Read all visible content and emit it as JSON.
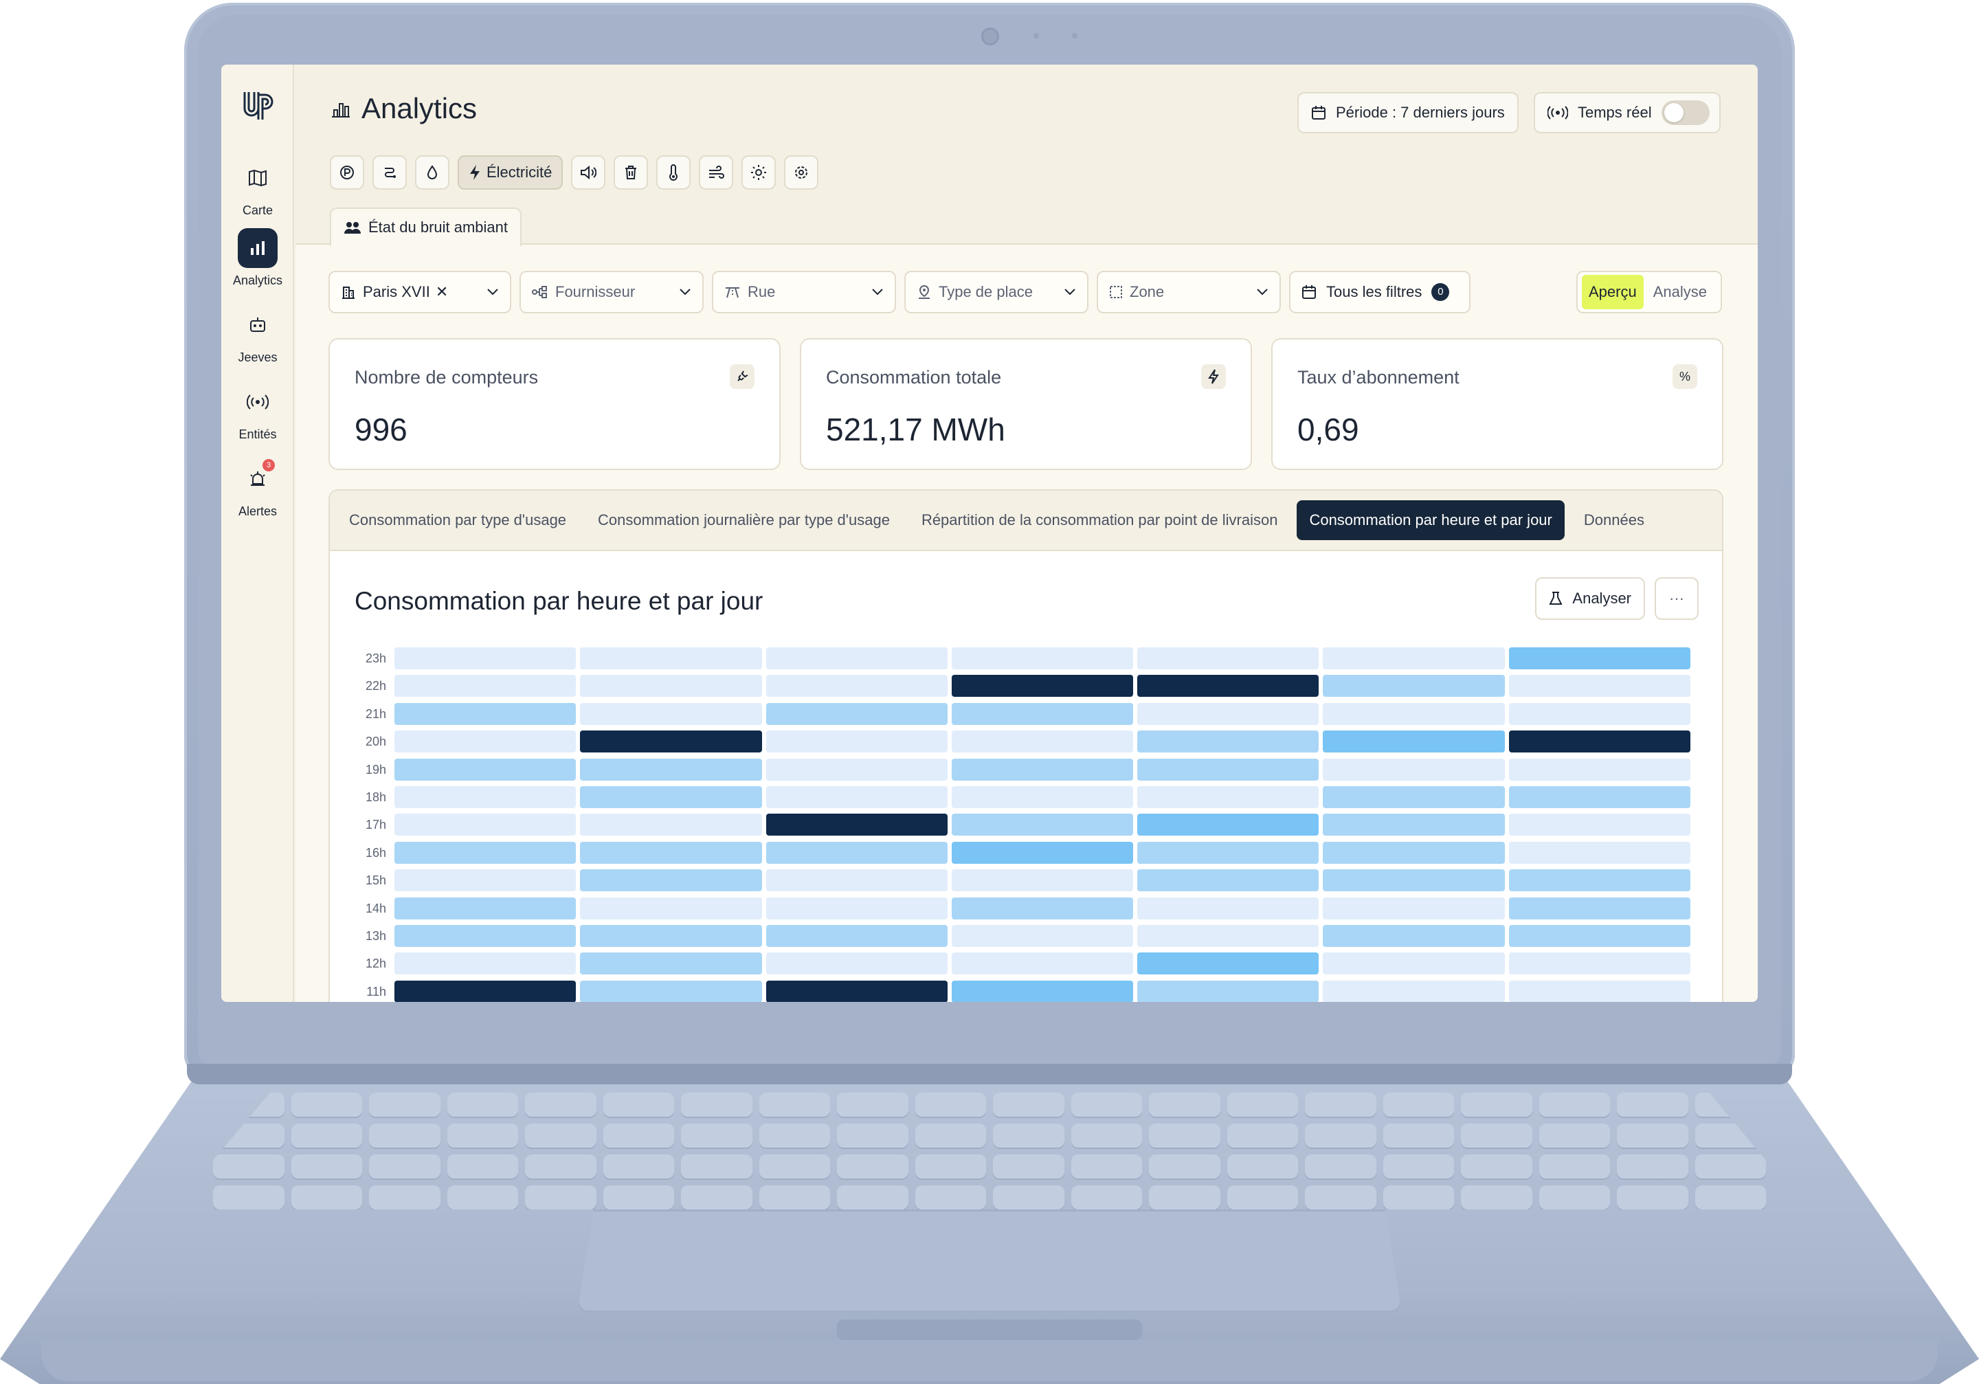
{
  "app": {
    "page_title": "Analytics",
    "period_label": "Période : 7 derniers jours",
    "realtime_label": "Temps réel",
    "realtime_on": false,
    "active_category": "Électricité",
    "subtab_label": "État du bruit ambiant"
  },
  "sidebar": {
    "items": [
      {
        "label": "Carte",
        "icon": "map-icon",
        "active": false
      },
      {
        "label": "Analytics",
        "icon": "bar-chart-icon",
        "active": true
      },
      {
        "label": "Jeeves",
        "icon": "robot-icon",
        "active": false
      },
      {
        "label": "Entités",
        "icon": "broadcast-icon",
        "active": false
      },
      {
        "label": "Alertes",
        "icon": "siren-icon",
        "active": false,
        "badge": "3"
      }
    ]
  },
  "categories": [
    "parking-icon",
    "route-icon",
    "water-drop-icon",
    "lightning-icon",
    "speaker-icon",
    "trash-icon",
    "thermometer-icon",
    "wind-icon",
    "sun-icon",
    "settings-icon"
  ],
  "filters": {
    "city_chip": "Paris XVII",
    "supplier": "Fournisseur",
    "street": "Rue",
    "place_type": "Type de place",
    "zone": "Zone",
    "all_filters": "Tous les filtres",
    "all_filters_count": "0"
  },
  "view_toggle": {
    "selected": "Aperçu",
    "other": "Analyse"
  },
  "kpis": [
    {
      "label": "Nombre de compteurs",
      "value": "996",
      "icon": "plug-icon"
    },
    {
      "label": "Consommation totale",
      "value": "521,17 MWh",
      "icon": "lightning-icon"
    },
    {
      "label": "Taux d’abonnement",
      "value": "0,69",
      "icon": "percent-icon"
    }
  ],
  "chart_tabs": [
    "Consommation par type d'usage",
    "Consommation journalière par type d'usage",
    "Répartition de la consommation par point de livraison",
    "Consommation par heure et par jour",
    "Données"
  ],
  "active_chart_tab": 3,
  "chart_buttons": {
    "analyse": "Analyser",
    "more": "···"
  },
  "colors": {
    "level0": "#e1edfb",
    "level1": "#a9d6f6",
    "level2": "#79c4f5",
    "level3": "#0f2a4a",
    "accent": "#e4f75f",
    "dark": "#16263b"
  },
  "chart_data": {
    "type": "heatmap",
    "title": "Consommation par heure et par jour",
    "y": [
      "23h",
      "22h",
      "21h",
      "20h",
      "19h",
      "18h",
      "17h",
      "16h",
      "15h",
      "14h",
      "13h",
      "12h",
      "11h"
    ],
    "x_count": 7,
    "levels": [
      [
        0,
        0,
        0,
        0,
        0,
        0,
        2
      ],
      [
        0,
        0,
        0,
        3,
        3,
        1,
        0
      ],
      [
        1,
        0,
        1,
        1,
        0,
        0,
        0
      ],
      [
        0,
        3,
        0,
        0,
        1,
        2,
        3
      ],
      [
        1,
        1,
        0,
        1,
        1,
        0,
        0
      ],
      [
        0,
        1,
        0,
        0,
        0,
        1,
        1
      ],
      [
        0,
        0,
        3,
        1,
        2,
        1,
        0
      ],
      [
        1,
        1,
        1,
        2,
        1,
        1,
        0
      ],
      [
        0,
        1,
        0,
        0,
        1,
        1,
        1
      ],
      [
        1,
        0,
        0,
        1,
        0,
        0,
        1
      ],
      [
        1,
        1,
        1,
        0,
        0,
        1,
        1
      ],
      [
        0,
        1,
        0,
        0,
        2,
        0,
        0
      ],
      [
        3,
        1,
        3,
        2,
        1,
        0,
        0
      ]
    ]
  }
}
